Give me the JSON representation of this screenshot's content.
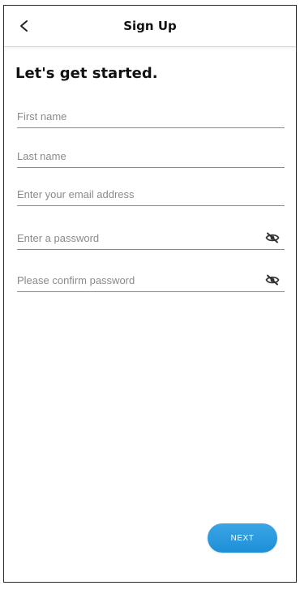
{
  "header": {
    "title": "Sign Up",
    "back_icon": "chevron-left-icon"
  },
  "heading": "Let's get started.",
  "form": {
    "first_name": {
      "placeholder": "First name",
      "value": ""
    },
    "last_name": {
      "placeholder": "Last name",
      "value": ""
    },
    "email": {
      "placeholder": "Enter your email address",
      "value": ""
    },
    "password": {
      "placeholder": "Enter a password",
      "value": "",
      "icon": "eye-off-icon"
    },
    "confirm_password": {
      "placeholder": "Please confirm password",
      "value": "",
      "icon": "eye-off-icon"
    }
  },
  "next_button": {
    "label": "NEXT"
  },
  "colors": {
    "accent": "#2a9ce0",
    "border": "#2b2b2b",
    "underline": "#8a8a8a"
  }
}
